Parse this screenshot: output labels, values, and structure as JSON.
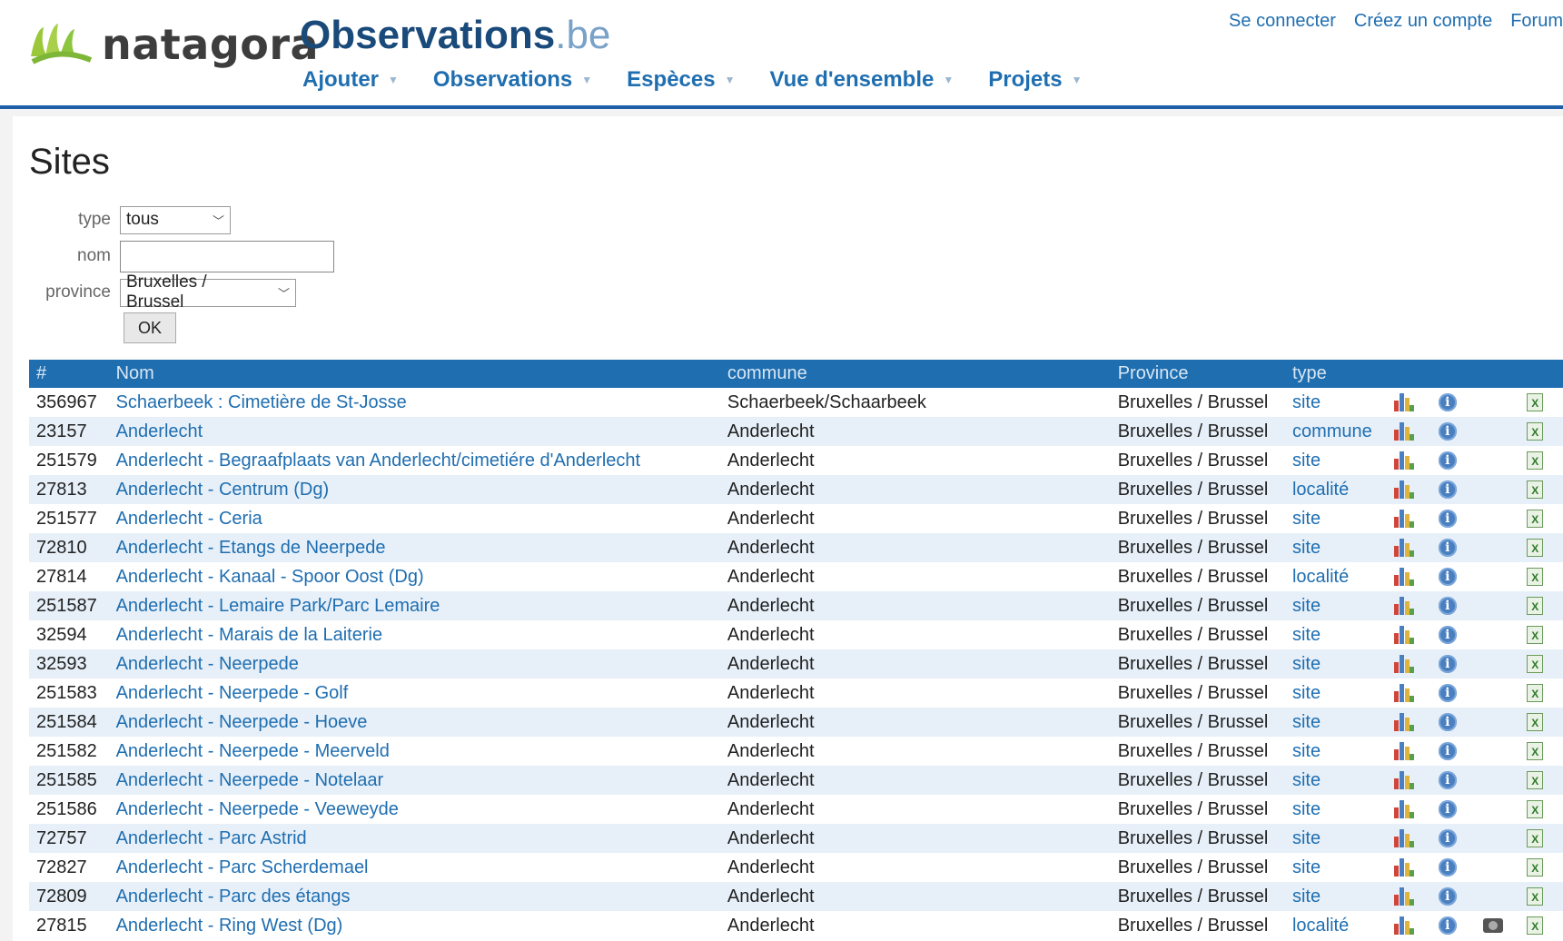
{
  "header": {
    "logo_text": "natagora",
    "site_title": "Observations",
    "site_tld": ".be",
    "nav": [
      {
        "label": "Ajouter"
      },
      {
        "label": "Observations"
      },
      {
        "label": "Espèces"
      },
      {
        "label": "Vue d'ensemble"
      },
      {
        "label": "Projets"
      }
    ],
    "top_links": {
      "login": "Se connecter",
      "register": "Créez un compte",
      "forum": "Forum"
    }
  },
  "page": {
    "title": "Sites"
  },
  "filters": {
    "type_label": "type",
    "type_value": "tous",
    "name_label": "nom",
    "name_value": "",
    "province_label": "province",
    "province_value": "Bruxelles / Brussel",
    "ok_label": "OK"
  },
  "table": {
    "headers": {
      "id": "#",
      "name": "Nom",
      "commune": "commune",
      "province": "Province",
      "type": "type"
    },
    "rows": [
      {
        "id": "356967",
        "name": "Schaerbeek : Cimetière de St-Josse",
        "commune": "Schaerbeek/Schaarbeek",
        "province": "Bruxelles / Brussel",
        "type": "site",
        "photo": false
      },
      {
        "id": "23157",
        "name": "Anderlecht",
        "commune": "Anderlecht",
        "province": "Bruxelles / Brussel",
        "type": "commune",
        "photo": false
      },
      {
        "id": "251579",
        "name": "Anderlecht - Begraafplaats van Anderlecht/cimetiére d'Anderlecht",
        "commune": "Anderlecht",
        "province": "Bruxelles / Brussel",
        "type": "site",
        "photo": false
      },
      {
        "id": "27813",
        "name": "Anderlecht - Centrum (Dg)",
        "commune": "Anderlecht",
        "province": "Bruxelles / Brussel",
        "type": "localité",
        "photo": false
      },
      {
        "id": "251577",
        "name": "Anderlecht - Ceria",
        "commune": "Anderlecht",
        "province": "Bruxelles / Brussel",
        "type": "site",
        "photo": false
      },
      {
        "id": "72810",
        "name": "Anderlecht - Etangs de Neerpede",
        "commune": "Anderlecht",
        "province": "Bruxelles / Brussel",
        "type": "site",
        "photo": false
      },
      {
        "id": "27814",
        "name": "Anderlecht - Kanaal - Spoor Oost (Dg)",
        "commune": "Anderlecht",
        "province": "Bruxelles / Brussel",
        "type": "localité",
        "photo": false
      },
      {
        "id": "251587",
        "name": "Anderlecht - Lemaire Park/Parc Lemaire",
        "commune": "Anderlecht",
        "province": "Bruxelles / Brussel",
        "type": "site",
        "photo": false
      },
      {
        "id": "32594",
        "name": "Anderlecht - Marais de la Laiterie",
        "commune": "Anderlecht",
        "province": "Bruxelles / Brussel",
        "type": "site",
        "photo": false
      },
      {
        "id": "32593",
        "name": "Anderlecht - Neerpede",
        "commune": "Anderlecht",
        "province": "Bruxelles / Brussel",
        "type": "site",
        "photo": false
      },
      {
        "id": "251583",
        "name": "Anderlecht - Neerpede - Golf",
        "commune": "Anderlecht",
        "province": "Bruxelles / Brussel",
        "type": "site",
        "photo": false
      },
      {
        "id": "251584",
        "name": "Anderlecht - Neerpede - Hoeve",
        "commune": "Anderlecht",
        "province": "Bruxelles / Brussel",
        "type": "site",
        "photo": false
      },
      {
        "id": "251582",
        "name": "Anderlecht - Neerpede - Meerveld",
        "commune": "Anderlecht",
        "province": "Bruxelles / Brussel",
        "type": "site",
        "photo": false
      },
      {
        "id": "251585",
        "name": "Anderlecht - Neerpede - Notelaar",
        "commune": "Anderlecht",
        "province": "Bruxelles / Brussel",
        "type": "site",
        "photo": false
      },
      {
        "id": "251586",
        "name": "Anderlecht - Neerpede - Veeweyde",
        "commune": "Anderlecht",
        "province": "Bruxelles / Brussel",
        "type": "site",
        "photo": false
      },
      {
        "id": "72757",
        "name": "Anderlecht - Parc Astrid",
        "commune": "Anderlecht",
        "province": "Bruxelles / Brussel",
        "type": "site",
        "photo": false
      },
      {
        "id": "72827",
        "name": "Anderlecht - Parc Scherdemael",
        "commune": "Anderlecht",
        "province": "Bruxelles / Brussel",
        "type": "site",
        "photo": false
      },
      {
        "id": "72809",
        "name": "Anderlecht - Parc des étangs",
        "commune": "Anderlecht",
        "province": "Bruxelles / Brussel",
        "type": "site",
        "photo": false
      },
      {
        "id": "27815",
        "name": "Anderlecht - Ring West (Dg)",
        "commune": "Anderlecht",
        "province": "Bruxelles / Brussel",
        "type": "localité",
        "photo": true
      }
    ]
  },
  "icons": {
    "chart": "bar-chart-icon",
    "info": "info-icon",
    "photo": "camera-icon",
    "export": "excel-icon"
  },
  "colors": {
    "brand_blue": "#1f6eb0",
    "row_alt": "#e7f0f9",
    "logo_green": "#8cc63f"
  }
}
